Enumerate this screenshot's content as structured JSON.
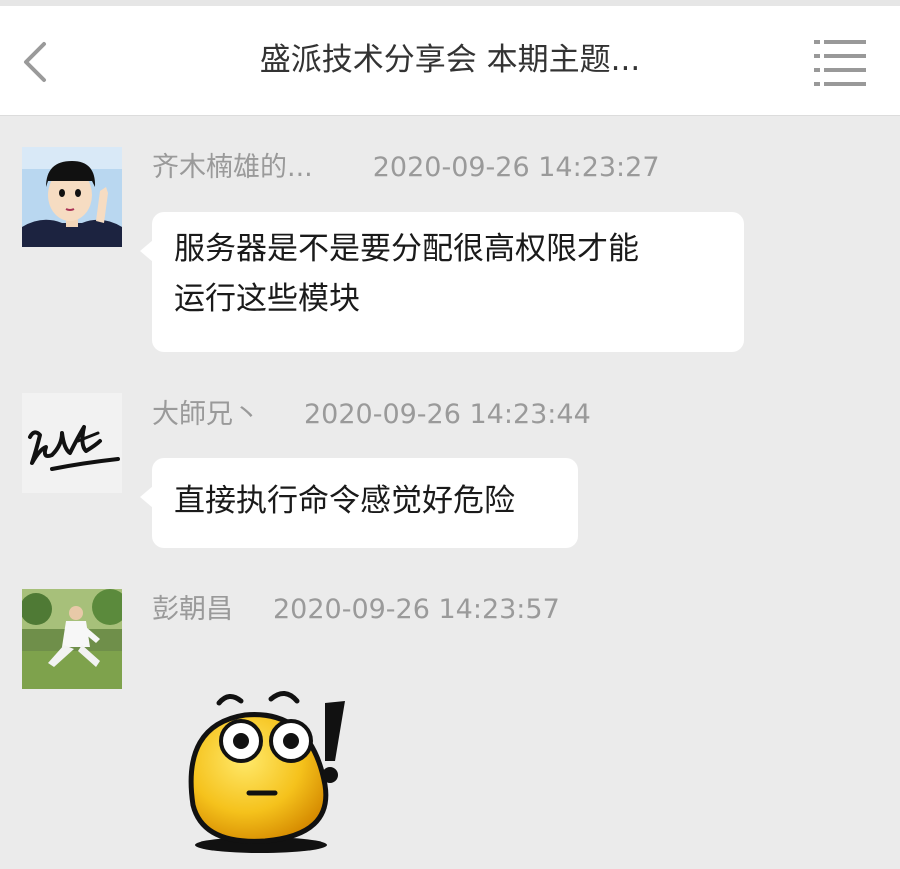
{
  "header": {
    "title": "盛派技术分享会 本期主题...",
    "back_icon": "chevron-left-icon",
    "menu_icon": "list-menu-icon"
  },
  "messages": [
    {
      "sender": "齐木楠雄的...",
      "time": "2020-09-26 14:23:27",
      "text_lines": [
        "服务器是不是要分配很高权限才能",
        "运行这些模块"
      ]
    },
    {
      "sender": "大師兄丶",
      "time": "2020-09-26 14:23:44",
      "text_lines": [
        "直接执行命令感觉好危险"
      ]
    },
    {
      "sender": "彭朝昌",
      "time": "2020-09-26 14:23:57",
      "sticker": "surprised-emoji-sticker"
    }
  ],
  "colors": {
    "background": "#ebebeb",
    "header": "#ffffff",
    "bubble": "#ffffff",
    "meta_text": "#9a9a9a",
    "title_text": "#333333"
  }
}
